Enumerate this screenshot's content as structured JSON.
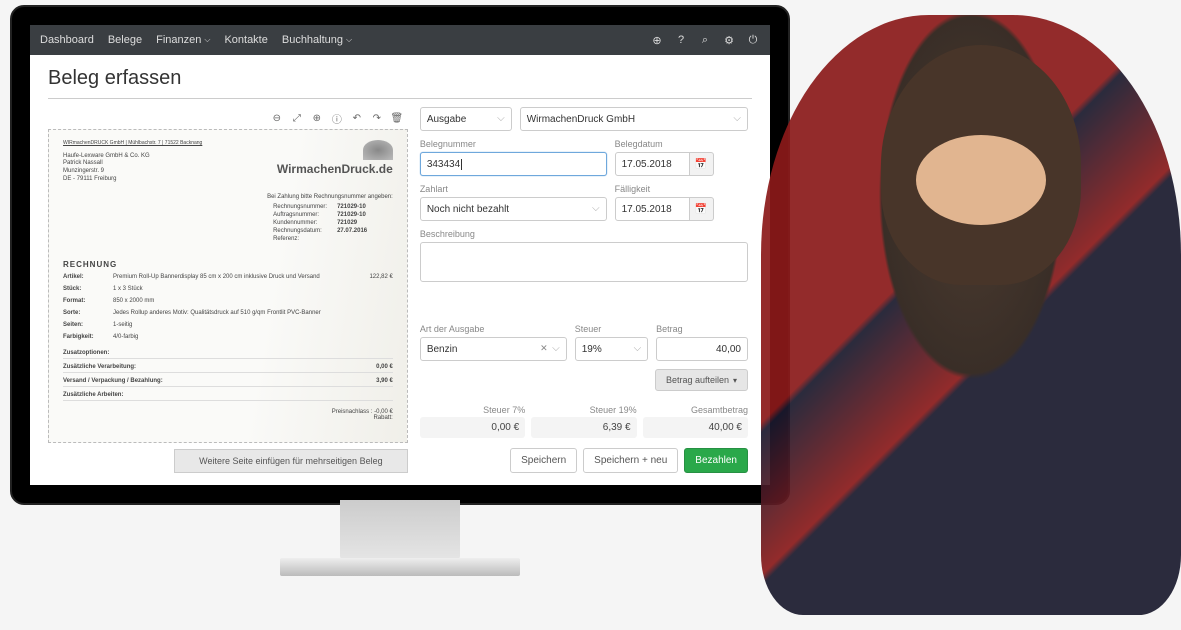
{
  "nav": {
    "items": [
      "Dashboard",
      "Belege",
      "Finanzen",
      "Kontakte",
      "Buchhaltung"
    ],
    "has_dropdown": [
      false,
      false,
      true,
      false,
      true
    ]
  },
  "page_title": "Beleg erfassen",
  "doc": {
    "logo": "WirmachenDruck.de",
    "sender_line": "WIRmachenDRUCK GmbH | Mühlbachstr. 7 | 71522 Backnang",
    "addr": [
      "Haufe-Lexware GmbH & Co. KG",
      "Patrick Nassall",
      "Munzingerstr. 9",
      "DE - 79111 Freiburg"
    ],
    "pay_hint": "Bei Zahlung bitte Rechnungsnummer angeben:",
    "meta": [
      {
        "k": "Rechnungsnummer:",
        "v": "721029-10"
      },
      {
        "k": "Auftragsnummer:",
        "v": "721029-10"
      },
      {
        "k": "Kundennummer:",
        "v": "721029"
      },
      {
        "k": "Rechnungsdatum:",
        "v": "27.07.2016"
      },
      {
        "k": "Referenz:",
        "v": ""
      }
    ],
    "section": "RECHNUNG",
    "lines": [
      {
        "label": "Artikel:",
        "text": "Premium Roll-Up Bannerdisplay 85 cm x 200 cm inklusive Druck und Versand",
        "amount": "122,82 €"
      },
      {
        "label": "Stück:",
        "text": "1 x 3 Stück",
        "amount": ""
      },
      {
        "label": "Format:",
        "text": "850 x 2000 mm",
        "amount": ""
      },
      {
        "label": "Sorte:",
        "text": "Jedes Rollup anderes Motiv: Qualitätsdruck auf 510 g/qm Frontlit PVC-Banner",
        "amount": ""
      },
      {
        "label": "Seiten:",
        "text": "1-seitig",
        "amount": ""
      },
      {
        "label": "Farbigkeit:",
        "text": "4/0-farbig",
        "amount": ""
      }
    ],
    "extra": [
      {
        "text": "Zusatzoptionen:",
        "amount": ""
      },
      {
        "text": "Zusätzliche Verarbeitung:",
        "amount": "0,00 €"
      },
      {
        "text": "Versand / Verpackung / Bezahlung:",
        "amount": "3,90 €"
      },
      {
        "text": "Zusätzliche Arbeiten:",
        "amount": ""
      }
    ],
    "footer": [
      {
        "text": "Preisnachlass :",
        "amount": "-0,00 €"
      },
      {
        "text": "Rabatt:",
        "amount": ""
      }
    ],
    "add_page": "Weitere Seite einfügen für mehrseitigen Beleg"
  },
  "form": {
    "type_field": "Ausgabe",
    "vendor": "WirmachenDruck GmbH",
    "belegnummer_label": "Belegnummer",
    "belegnummer": "343434",
    "belegdatum_label": "Belegdatum",
    "belegdatum": "17.05.2018",
    "zahlart_label": "Zahlart",
    "zahlart": "Noch nicht bezahlt",
    "faelligkeit_label": "Fälligkeit",
    "faelligkeit": "17.05.2018",
    "beschreibung_label": "Beschreibung",
    "art_label": "Art der Ausgabe",
    "art": "Benzin",
    "steuer_label": "Steuer",
    "steuer": "19%",
    "betrag_label": "Betrag",
    "betrag": "40,00",
    "split": "Betrag aufteilen",
    "totals": [
      {
        "label": "Steuer 7%",
        "val": "0,00 €"
      },
      {
        "label": "Steuer 19%",
        "val": "6,39 €"
      },
      {
        "label": "Gesamtbetrag",
        "val": "40,00 €"
      }
    ],
    "save": "Speichern",
    "save_new": "Speichern + neu",
    "pay": "Bezahlen"
  }
}
